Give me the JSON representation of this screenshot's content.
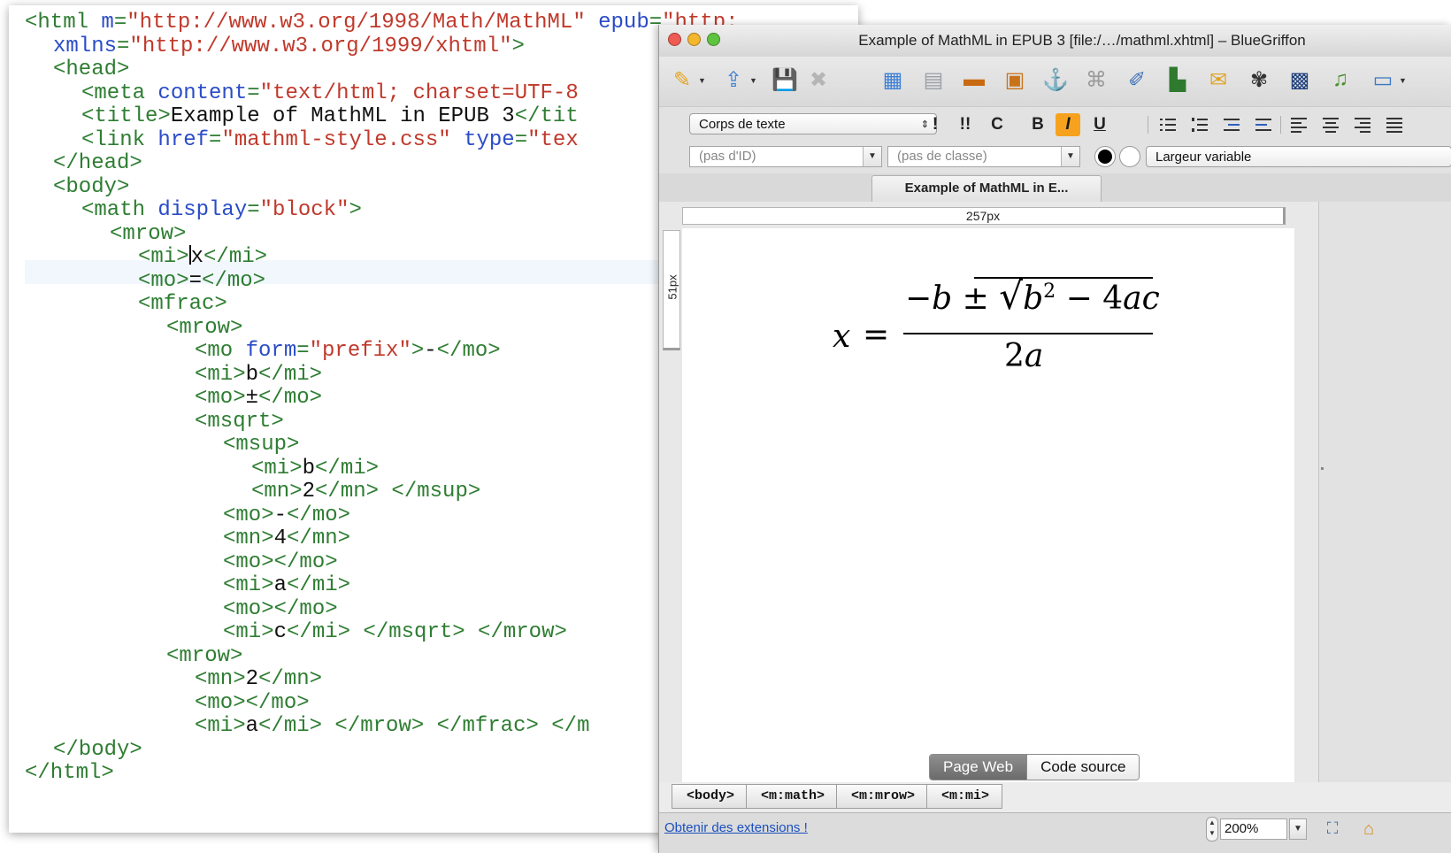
{
  "code_editor": {
    "lines": [
      {
        "indent": 0,
        "parts": [
          [
            "tg",
            "<html "
          ],
          [
            "at",
            "m"
          ],
          [
            "tg",
            "="
          ],
          [
            "st",
            "\"http://www.w3.org/1998/Math/MathML\""
          ],
          [
            "tg",
            " "
          ],
          [
            "at",
            "epub"
          ],
          [
            "tg",
            "="
          ],
          [
            "st",
            "\"http:"
          ]
        ]
      },
      {
        "indent": 1,
        "parts": [
          [
            "at",
            "xmlns"
          ],
          [
            "tg",
            "="
          ],
          [
            "st",
            "\"http://www.w3.org/1999/xhtml\""
          ],
          [
            "tg",
            ">"
          ]
        ]
      },
      {
        "indent": 1,
        "parts": [
          [
            "tg",
            "<head>"
          ]
        ]
      },
      {
        "indent": 2,
        "parts": [
          [
            "tg",
            "<meta "
          ],
          [
            "at",
            "content"
          ],
          [
            "tg",
            "="
          ],
          [
            "st",
            "\"text/html; charset=UTF-8"
          ]
        ]
      },
      {
        "indent": 2,
        "parts": [
          [
            "tg",
            "<title>"
          ],
          [
            "tx",
            "Example of MathML in EPUB 3"
          ],
          [
            "tg",
            "</tit"
          ]
        ]
      },
      {
        "indent": 2,
        "parts": [
          [
            "tg",
            "<link "
          ],
          [
            "at",
            "href"
          ],
          [
            "tg",
            "="
          ],
          [
            "st",
            "\"mathml-style.css\""
          ],
          [
            "tg",
            " "
          ],
          [
            "at",
            "type"
          ],
          [
            "tg",
            "="
          ],
          [
            "st",
            "\"tex"
          ]
        ]
      },
      {
        "indent": 1,
        "parts": [
          [
            "tg",
            "</head>"
          ]
        ]
      },
      {
        "indent": 1,
        "parts": [
          [
            "tg",
            "<body>"
          ]
        ]
      },
      {
        "indent": 2,
        "parts": [
          [
            "tg",
            "<math "
          ],
          [
            "at",
            "display"
          ],
          [
            "tg",
            "="
          ],
          [
            "st",
            "\"block\""
          ],
          [
            "tg",
            ">"
          ]
        ]
      },
      {
        "indent": 3,
        "parts": [
          [
            "tg",
            "<mrow>"
          ]
        ]
      },
      {
        "indent": 4,
        "parts": [
          [
            "tg",
            "<mi>"
          ],
          [
            "caret",
            ""
          ],
          [
            "tx",
            "x"
          ],
          [
            "tg",
            "</mi>"
          ]
        ]
      },
      {
        "indent": 4,
        "parts": [
          [
            "tg",
            "<mo>"
          ],
          [
            "tx",
            "="
          ],
          [
            "tg",
            "</mo>"
          ]
        ]
      },
      {
        "indent": 4,
        "parts": [
          [
            "tg",
            "<mfrac>"
          ]
        ]
      },
      {
        "indent": 5,
        "parts": [
          [
            "tg",
            "<mrow>"
          ]
        ]
      },
      {
        "indent": 6,
        "parts": [
          [
            "tg",
            "<mo "
          ],
          [
            "at",
            "form"
          ],
          [
            "tg",
            "="
          ],
          [
            "st",
            "\"prefix\""
          ],
          [
            "tg",
            ">"
          ],
          [
            "tx",
            "-"
          ],
          [
            "tg",
            "</mo>"
          ]
        ]
      },
      {
        "indent": 6,
        "parts": [
          [
            "tg",
            "<mi>"
          ],
          [
            "tx",
            "b"
          ],
          [
            "tg",
            "</mi>"
          ]
        ]
      },
      {
        "indent": 6,
        "parts": [
          [
            "tg",
            "<mo>"
          ],
          [
            "tx",
            "±"
          ],
          [
            "tg",
            "</mo>"
          ]
        ]
      },
      {
        "indent": 6,
        "parts": [
          [
            "tg",
            "<msqrt>"
          ]
        ]
      },
      {
        "indent": 7,
        "parts": [
          [
            "tg",
            "<msup>"
          ]
        ]
      },
      {
        "indent": 8,
        "parts": [
          [
            "tg",
            "<mi>"
          ],
          [
            "tx",
            "b"
          ],
          [
            "tg",
            "</mi>"
          ]
        ]
      },
      {
        "indent": 8,
        "parts": [
          [
            "tg",
            "<mn>"
          ],
          [
            "tx",
            "2"
          ],
          [
            "tg",
            "</mn> </msup>"
          ]
        ]
      },
      {
        "indent": 7,
        "parts": [
          [
            "tg",
            "<mo>"
          ],
          [
            "tx",
            "-"
          ],
          [
            "tg",
            "</mo>"
          ]
        ]
      },
      {
        "indent": 7,
        "parts": [
          [
            "tg",
            "<mn>"
          ],
          [
            "tx",
            "4"
          ],
          [
            "tg",
            "</mn>"
          ]
        ]
      },
      {
        "indent": 7,
        "parts": [
          [
            "tg",
            "<mo></mo>"
          ]
        ]
      },
      {
        "indent": 7,
        "parts": [
          [
            "tg",
            "<mi>"
          ],
          [
            "tx",
            "a"
          ],
          [
            "tg",
            "</mi>"
          ]
        ]
      },
      {
        "indent": 7,
        "parts": [
          [
            "tg",
            "<mo></mo>"
          ]
        ]
      },
      {
        "indent": 7,
        "parts": [
          [
            "tg",
            "<mi>"
          ],
          [
            "tx",
            "c"
          ],
          [
            "tg",
            "</mi> </msqrt> </mrow>"
          ]
        ]
      },
      {
        "indent": 5,
        "parts": [
          [
            "tg",
            "<mrow>"
          ]
        ]
      },
      {
        "indent": 6,
        "parts": [
          [
            "tg",
            "<mn>"
          ],
          [
            "tx",
            "2"
          ],
          [
            "tg",
            "</mn>"
          ]
        ]
      },
      {
        "indent": 6,
        "parts": [
          [
            "tg",
            "<mo></mo>"
          ]
        ]
      },
      {
        "indent": 6,
        "parts": [
          [
            "tg",
            "<mi>"
          ],
          [
            "tx",
            "a"
          ],
          [
            "tg",
            "</mi> </mrow> </mfrac> </m"
          ]
        ]
      },
      {
        "indent": 1,
        "parts": [
          [
            "tg",
            "</body>"
          ]
        ]
      },
      {
        "indent": 0,
        "parts": [
          [
            "tg",
            "</html>"
          ]
        ]
      }
    ]
  },
  "window": {
    "title": "Example of MathML in EPUB 3 [file:/…/mathml.xhtml] – BlueGriffon"
  },
  "toolbar": {
    "icons": [
      {
        "name": "new-document-icon",
        "glyph": "✎",
        "color": "#e6a41c",
        "dropdown": true
      },
      {
        "name": "open-document-icon",
        "glyph": "⇪",
        "color": "#3f7fd1",
        "dropdown": true
      },
      {
        "name": "save-icon",
        "glyph": "💾",
        "color": "#888888",
        "dropdown": false
      },
      {
        "name": "close-document-icon",
        "glyph": "✖",
        "color": "#b5b5b5",
        "dropdown": false
      },
      {
        "name": "table-icon",
        "glyph": "▦",
        "color": "#3d7fd6",
        "dropdown": false
      },
      {
        "name": "layer-icon",
        "glyph": "▤",
        "color": "#9aa0a6",
        "dropdown": false
      },
      {
        "name": "image-icon",
        "glyph": "▬",
        "color": "#c96a12",
        "dropdown": false
      },
      {
        "name": "image-map-icon",
        "glyph": "▣",
        "color": "#c8731a",
        "dropdown": false
      },
      {
        "name": "anchor-icon",
        "glyph": "⚓",
        "color": "#7a7a7a",
        "dropdown": false
      },
      {
        "name": "form-icon",
        "glyph": "⌘",
        "color": "#9b9b9b",
        "dropdown": false
      },
      {
        "name": "link-icon",
        "glyph": "✐",
        "color": "#3c6fb4",
        "dropdown": false
      },
      {
        "name": "chart-icon",
        "glyph": "▙",
        "color": "#2f7a2f",
        "dropdown": false
      },
      {
        "name": "css-icon",
        "glyph": "✉",
        "color": "#e0a21f",
        "dropdown": false
      },
      {
        "name": "effects-icon",
        "glyph": "✾",
        "color": "#333333",
        "dropdown": false
      },
      {
        "name": "video-icon",
        "glyph": "▩",
        "color": "#1f3f7a",
        "dropdown": false
      },
      {
        "name": "audio-icon",
        "glyph": "♫",
        "color": "#4a8f2c",
        "dropdown": false
      },
      {
        "name": "window-icon",
        "glyph": "▭",
        "color": "#3b78c4",
        "dropdown": true
      }
    ]
  },
  "format_bar": {
    "paragraph_style": "Corps de texte",
    "buttons": [
      {
        "name": "emphasis-button",
        "label": "!",
        "active": false
      },
      {
        "name": "strong-button",
        "label": "!!",
        "active": false
      },
      {
        "name": "code-button",
        "label": "C",
        "active": false
      },
      {
        "name": "bold-button",
        "label": "B",
        "active": false
      },
      {
        "name": "italic-button",
        "label": "I",
        "active": true
      },
      {
        "name": "underline-button",
        "label": "U",
        "active": false
      }
    ]
  },
  "id_bar": {
    "id_placeholder": "(pas d'ID)",
    "class_placeholder": "(pas de classe)",
    "width_label": "Largeur variable"
  },
  "tabs": {
    "document_tab": "Example of MathML in E..."
  },
  "rulers": {
    "horizontal": "257px",
    "vertical": "51px"
  },
  "equation": {
    "lhs": "x",
    "equals": "=",
    "minus": "−",
    "b": "b",
    "pm": "±",
    "radical": "√",
    "b_sq": "b",
    "exp": "2",
    "minus2": "−",
    "coef": "4",
    "a": "a",
    "c": "c",
    "den_coef": "2",
    "den_var": "a"
  },
  "view_modes": {
    "page_web": "Page Web",
    "source": "Code source"
  },
  "breadcrumb": [
    "<body>",
    "<m:math>",
    "<m:mrow>",
    "<m:mi>"
  ],
  "status": {
    "extensions_link": "Obtenir des extensions !",
    "zoom": "200%"
  }
}
